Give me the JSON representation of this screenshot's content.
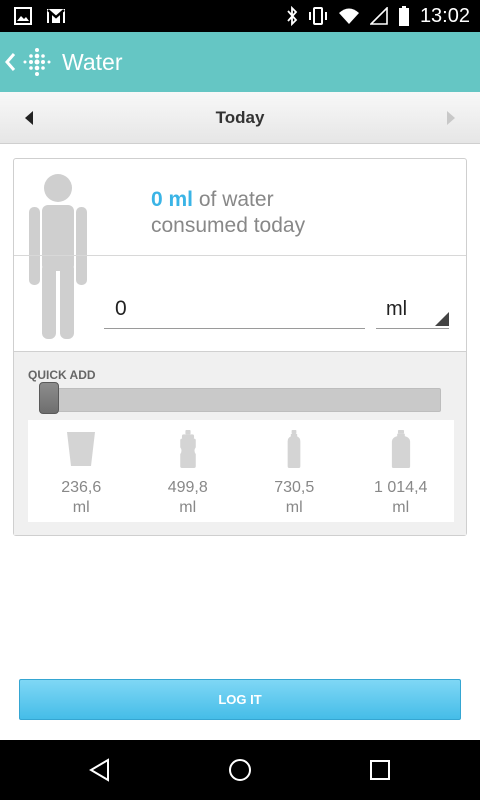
{
  "status_bar": {
    "time": "13:02",
    "left_icons": [
      "image-icon",
      "gmail-icon"
    ],
    "right_icons": [
      "bluetooth-icon",
      "vibrate-icon",
      "wifi-icon",
      "signal-icon",
      "battery-icon"
    ]
  },
  "app_bar": {
    "title": "Water",
    "back_icon": "chevron-left-icon",
    "logo_icon": "fitbit-logo-icon"
  },
  "date_nav": {
    "label": "Today"
  },
  "summary": {
    "amount": "0 ml",
    "line1_rest": " of water",
    "line2": "consumed today"
  },
  "entry": {
    "amount_value": "0",
    "unit": "ml"
  },
  "quick_add": {
    "label": "QUICK ADD",
    "slider_value": 0,
    "presets": [
      {
        "value": "236,6",
        "unit": "ml",
        "icon": "glass-icon"
      },
      {
        "value": "499,8",
        "unit": "ml",
        "icon": "sport-bottle-icon"
      },
      {
        "value": "730,5",
        "unit": "ml",
        "icon": "bottle-icon"
      },
      {
        "value": "1 014,4",
        "unit": "ml",
        "icon": "large-bottle-icon"
      }
    ]
  },
  "log_button": {
    "label": "LOG IT"
  },
  "colors": {
    "app_bar": "#65c6c4",
    "accent": "#3ab4e6",
    "button": "#45bde8"
  }
}
